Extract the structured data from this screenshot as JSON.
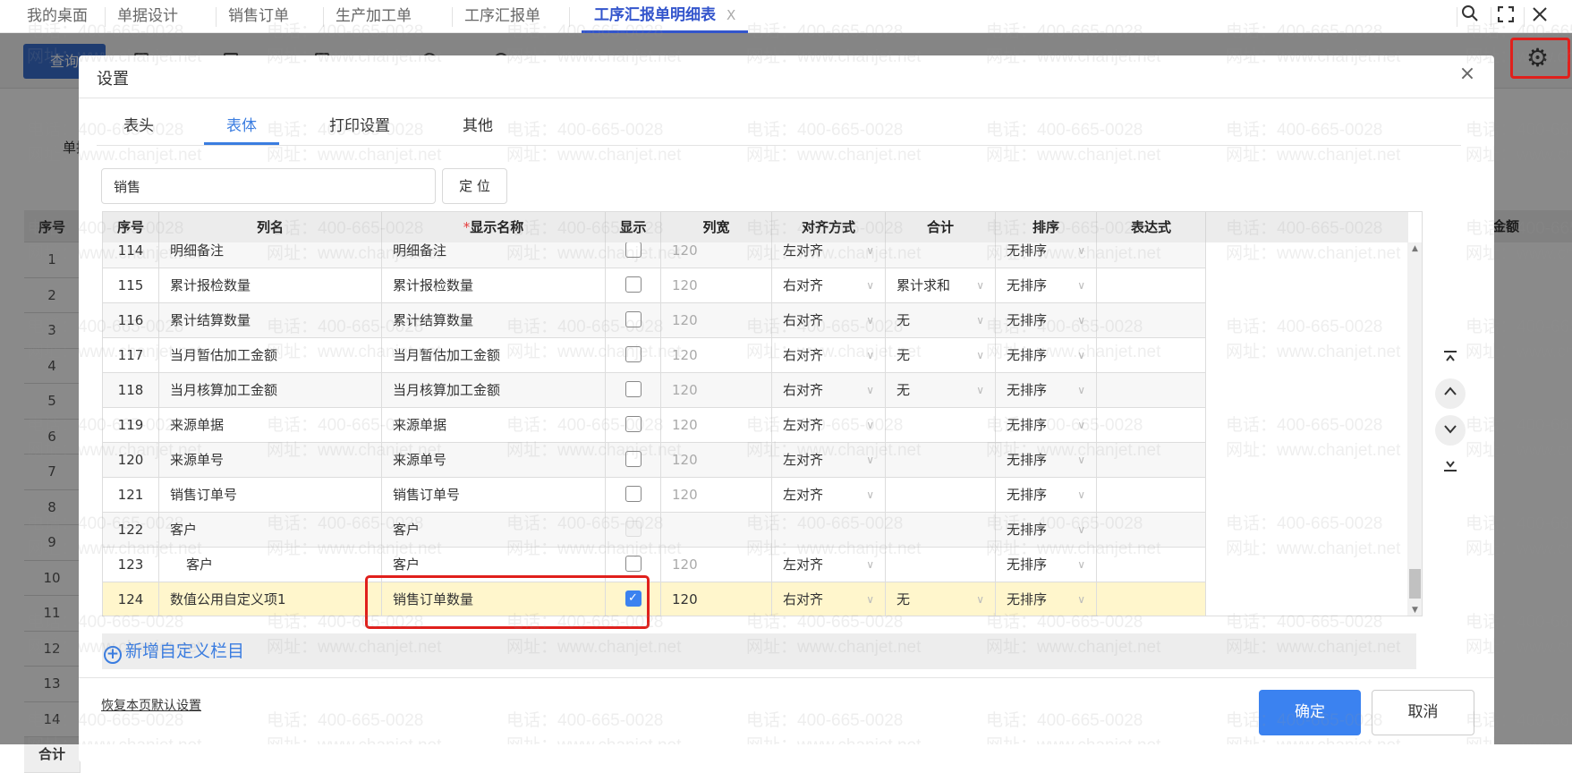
{
  "top_tabs": [
    {
      "label": "我的桌面",
      "active": false
    },
    {
      "label": "单据设计",
      "active": false
    },
    {
      "label": "销售订单",
      "active": false
    },
    {
      "label": "生产加工单",
      "active": false
    },
    {
      "label": "工序汇报单",
      "active": false
    },
    {
      "label": "工序汇报单明细表",
      "active": true,
      "close": "X"
    }
  ],
  "window_controls": {
    "search": "search-icon",
    "fullscreen": "fullscreen-icon",
    "close": "close-icon"
  },
  "background": {
    "query_button": "查询",
    "partial_label": "单据",
    "seq_header": "序号",
    "amount_header": "金额",
    "row_numbers": [
      "1",
      "2",
      "3",
      "4",
      "5",
      "6",
      "7",
      "8",
      "9",
      "10",
      "11",
      "12",
      "13",
      "14"
    ],
    "total_label": "合计"
  },
  "dialog": {
    "title": "设置",
    "tabs": [
      "表头",
      "表体",
      "打印设置",
      "其他"
    ],
    "active_tab": 1,
    "search": {
      "value": "销售"
    },
    "locate_button": "定 位",
    "table": {
      "headers": [
        "序号",
        "列名",
        "显示名称",
        "显示",
        "列宽",
        "对齐方式",
        "合计",
        "排序",
        "表达式"
      ],
      "required_marker": "*",
      "rows": [
        {
          "seq": "114",
          "name": "明细备注",
          "display": "明细备注",
          "show": false,
          "width": "120",
          "align": "左对齐",
          "total": "",
          "sort": "无排序"
        },
        {
          "seq": "115",
          "name": "累计报检数量",
          "display": "累计报检数量",
          "show": false,
          "width": "120",
          "align": "右对齐",
          "total": "累计求和",
          "sort": "无排序"
        },
        {
          "seq": "116",
          "name": "累计结算数量",
          "display": "累计结算数量",
          "show": false,
          "width": "120",
          "align": "右对齐",
          "total": "无",
          "sort": "无排序"
        },
        {
          "seq": "117",
          "name": "当月暂估加工金额",
          "display": "当月暂估加工金额",
          "show": false,
          "width": "120",
          "align": "右对齐",
          "total": "无",
          "sort": "无排序"
        },
        {
          "seq": "118",
          "name": "当月核算加工金额",
          "display": "当月核算加工金额",
          "show": false,
          "width": "120",
          "align": "右对齐",
          "total": "无",
          "sort": "无排序"
        },
        {
          "seq": "119",
          "name": "来源单据",
          "display": "来源单据",
          "show": false,
          "width": "120",
          "align": "左对齐",
          "total": "",
          "sort": "无排序"
        },
        {
          "seq": "120",
          "name": "来源单号",
          "display": "来源单号",
          "show": false,
          "width": "120",
          "align": "左对齐",
          "total": "",
          "sort": "无排序"
        },
        {
          "seq": "121",
          "name": "销售订单号",
          "display": "销售订单号",
          "show": false,
          "width": "120",
          "align": "左对齐",
          "total": "",
          "sort": "无排序"
        },
        {
          "seq": "122",
          "name": "客户",
          "display": "客户",
          "show": false,
          "disabled": true,
          "width": "",
          "align": "",
          "total": "",
          "sort": "无排序"
        },
        {
          "seq": "123",
          "name": "客户",
          "indent": true,
          "display": "客户",
          "show": false,
          "width": "120",
          "align": "左对齐",
          "total": "",
          "sort": "无排序"
        },
        {
          "seq": "124",
          "name": "数值公用自定义项1",
          "display": "销售订单数量",
          "show": true,
          "selected": true,
          "width": "120",
          "align": "右对齐",
          "total": "无",
          "sort": "无排序"
        }
      ],
      "scroll_position": 0.95
    },
    "add_custom": "新增自定义栏目",
    "restore_default": "恢复本页默认设置",
    "ok_button": "确定",
    "cancel_button": "取消"
  },
  "watermark": {
    "phone": "电话：400-665-0028",
    "site": "网址：www.chanjet.net"
  },
  "colors": {
    "accent": "#3b82f0",
    "tab_active": "#3355cc",
    "highlight": "#e0201c",
    "selected_row": "#fff6cc"
  }
}
